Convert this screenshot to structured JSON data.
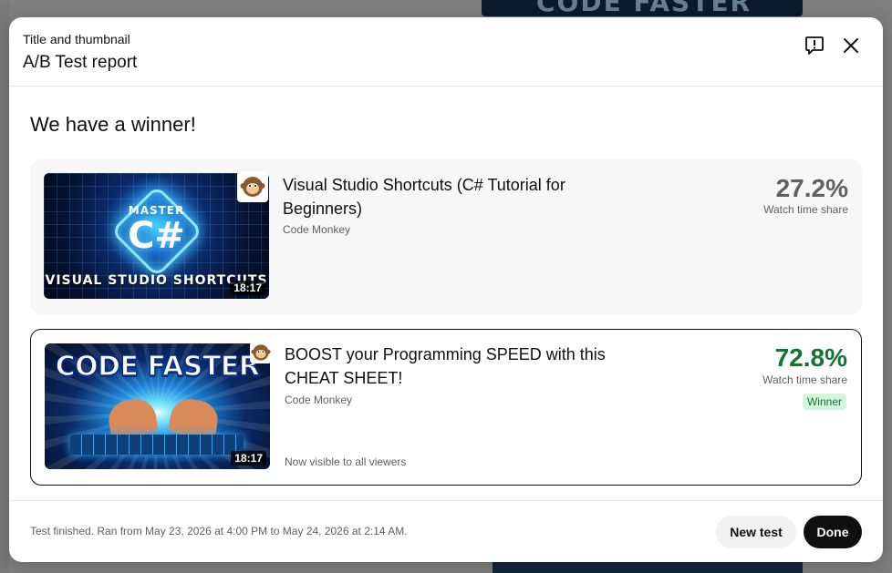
{
  "header": {
    "subtitle": "Title and thumbnail",
    "title": "A/B Test report"
  },
  "icons": {
    "feedback": "feedback-icon",
    "close": "close-icon",
    "avatar": "monkey-avatar-icon"
  },
  "body": {
    "heading": "We have a winner!"
  },
  "variants": [
    {
      "title": "Visual Studio Shortcuts (C# Tutorial for Beginners)",
      "channel": "Code Monkey",
      "duration": "18:17",
      "share": "27.2%",
      "share_label": "Watch time share",
      "thumb_text_top": "MASTER",
      "thumb_text_main": "C#",
      "thumb_text_bottom": "VISUAL STUDIO SHORTCUTS",
      "share_color": "#606060"
    },
    {
      "title": "BOOST your Programming SPEED with this CHEAT SHEET!",
      "channel": "Code Monkey",
      "duration": "18:17",
      "share": "72.8%",
      "share_label": "Watch time share",
      "badge": "Winner",
      "note": "Now visible to all viewers",
      "thumb_text_main": "CODE FASTER",
      "share_color": "#137333"
    }
  ],
  "footer": {
    "status": "Test finished. Ran from May 23, 2026 at 4:00 PM to May 24, 2026 at 2:14 AM.",
    "new_test_label": "New test",
    "done_label": "Done"
  },
  "colors": {
    "winner_green": "#137333",
    "winner_badge_bg": "#d3f5dd",
    "primary_button": "#0f0f0f"
  }
}
